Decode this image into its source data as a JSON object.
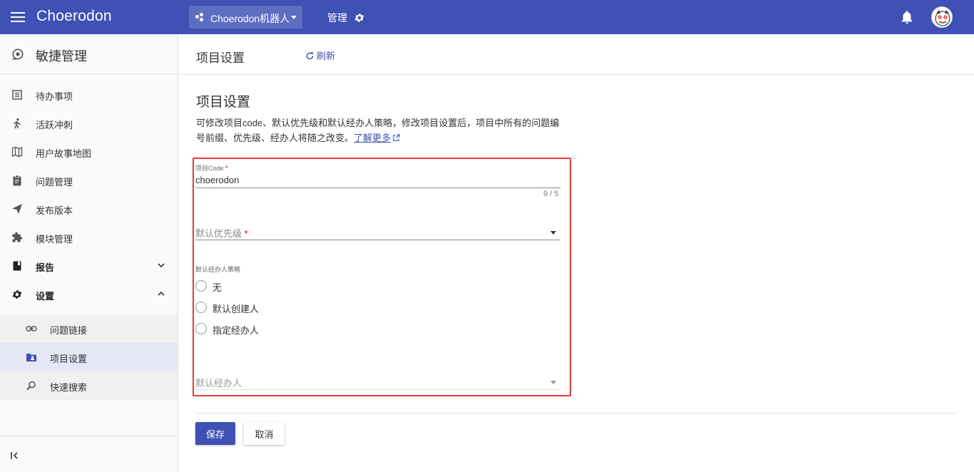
{
  "topbar": {
    "brand": "Choerodon",
    "project_name": "Choerodon机器人",
    "manage_label": "管理"
  },
  "sidebar": {
    "title": "敏捷管理",
    "items": [
      {
        "label": "待办事项",
        "icon": "backlog-list-icon"
      },
      {
        "label": "活跃冲刺",
        "icon": "running-man-icon"
      },
      {
        "label": "用户故事地图",
        "icon": "map-icon"
      },
      {
        "label": "问题管理",
        "icon": "clipboard-icon"
      },
      {
        "label": "发布版本",
        "icon": "paper-plane-icon"
      },
      {
        "label": "模块管理",
        "icon": "puzzle-icon"
      },
      {
        "label": "报告",
        "icon": "book-icon"
      },
      {
        "label": "设置",
        "icon": "gear-icon"
      }
    ],
    "sub_items": [
      {
        "label": "问题链接",
        "icon": "link-icon"
      },
      {
        "label": "项目设置",
        "icon": "folder-person-icon"
      },
      {
        "label": "快速搜索",
        "icon": "search-icon"
      }
    ]
  },
  "page": {
    "header_title": "项目设置",
    "refresh_label": "刷新",
    "section_title": "项目设置",
    "description": "可修改项目code、默认优先级和默认经办人策略，修改项目设置后，项目中所有的问题编号前缀、优先级、经办人将随之改变。",
    "learn_more": "了解更多"
  },
  "form": {
    "code_label": "项目Code",
    "code_value": "choerodon",
    "code_counter": "9 / 5",
    "priority_placeholder": "默认优先级",
    "assignee_strategy_label": "默认经办人策略",
    "strategy_options": [
      "无",
      "默认创建人",
      "指定经办人"
    ],
    "assignee_placeholder": "默认经办人",
    "required_mark": "*"
  },
  "actions": {
    "save_label": "保存",
    "cancel_label": "取消"
  },
  "colors": {
    "primary": "#3f51b5",
    "highlight_border": "#e53935",
    "required": "#d50000"
  }
}
